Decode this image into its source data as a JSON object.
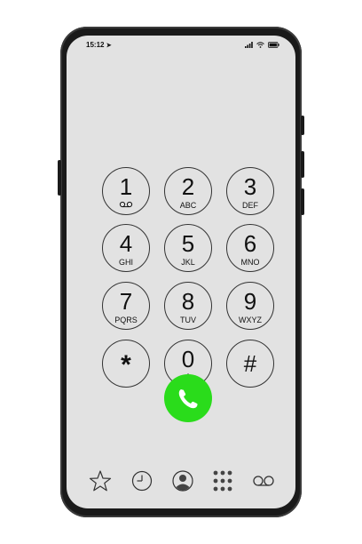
{
  "status_bar": {
    "time": "15:12",
    "location_arrow": "location-arrow-icon",
    "icons": [
      "signal-icon",
      "wifi-icon",
      "battery-icon"
    ]
  },
  "keypad": [
    {
      "digit": "1",
      "letters": "",
      "sub_icon": "voicemail-icon"
    },
    {
      "digit": "2",
      "letters": "ABC"
    },
    {
      "digit": "3",
      "letters": "DEF"
    },
    {
      "digit": "4",
      "letters": "GHI"
    },
    {
      "digit": "5",
      "letters": "JKL"
    },
    {
      "digit": "6",
      "letters": "MNO"
    },
    {
      "digit": "7",
      "letters": "PQRS"
    },
    {
      "digit": "8",
      "letters": "TUV"
    },
    {
      "digit": "9",
      "letters": "WXYZ"
    },
    {
      "digit": "*",
      "letters": ""
    },
    {
      "digit": "0",
      "letters": "+"
    },
    {
      "digit": "#",
      "letters": ""
    }
  ],
  "call_button": {
    "icon": "phone-handset-icon",
    "color": "#2adc1b"
  },
  "bottom_tabs": [
    "favorites-star-icon",
    "recents-clock-icon",
    "contacts-person-icon",
    "keypad-grid-icon",
    "voicemail-icon"
  ]
}
